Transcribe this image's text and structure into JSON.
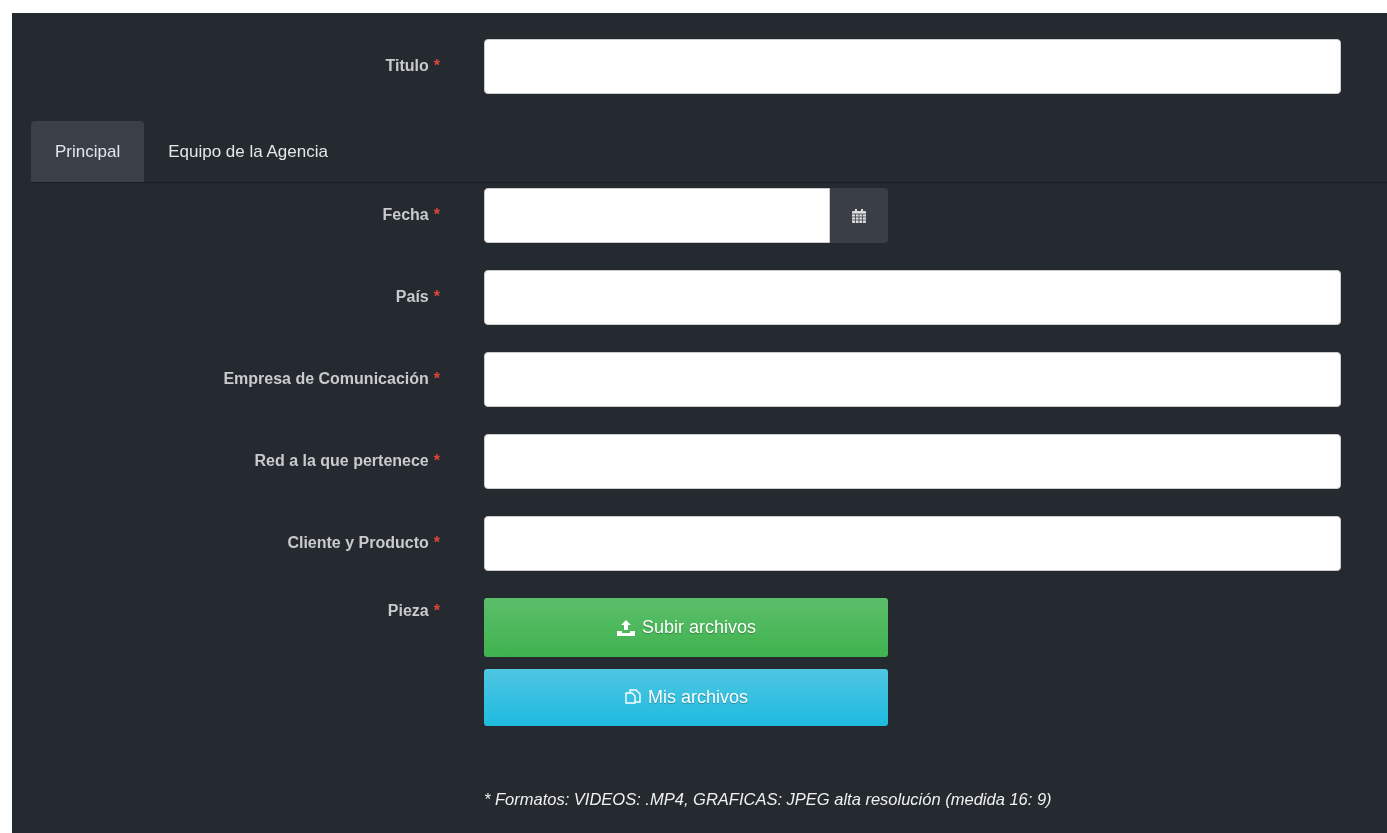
{
  "title_field": {
    "label": "Titulo",
    "required_mark": "*"
  },
  "tabs": [
    {
      "label": "Principal",
      "selected": true
    },
    {
      "label": "Equipo de la Agencia",
      "selected": false
    }
  ],
  "fields": [
    {
      "kind": "date",
      "label": "Fecha",
      "required_mark": "*"
    },
    {
      "kind": "text",
      "label": "País",
      "required_mark": "*"
    },
    {
      "kind": "text",
      "label": "Empresa de Comunicación",
      "required_mark": "*"
    },
    {
      "kind": "text",
      "label": "Red a la que pertenece",
      "required_mark": "*"
    },
    {
      "kind": "text",
      "label": "Cliente y Producto",
      "required_mark": "*"
    },
    {
      "kind": "upload",
      "label": "Pieza",
      "required_mark": "*",
      "buttons": [
        {
          "kind": "upload",
          "label": "Subir archivos"
        },
        {
          "kind": "files",
          "label": "Mis archivos"
        }
      ],
      "note": "* Formatos: VIDEOS: .MP4, GRAFICAS: JPEG alta resolución (medida 16: 9)"
    }
  ]
}
